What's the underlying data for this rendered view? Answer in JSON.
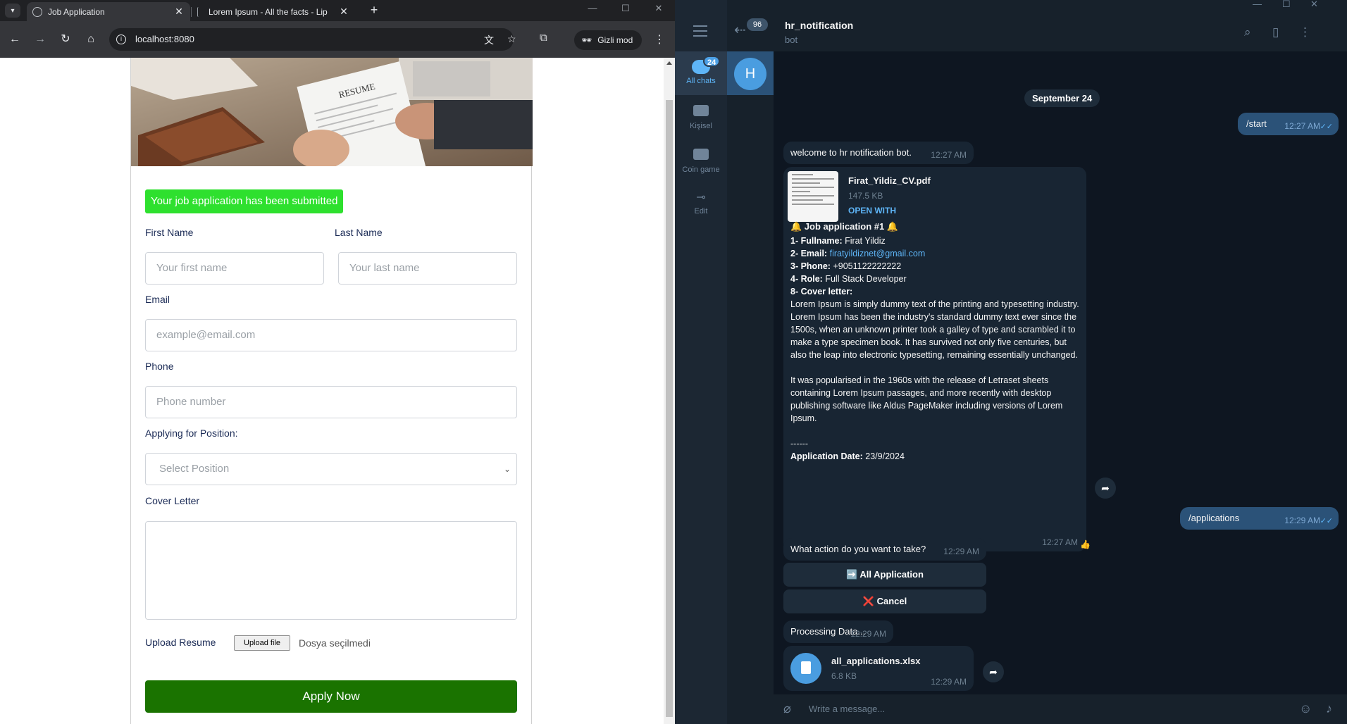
{
  "browser": {
    "tabs": [
      {
        "title": "Job Application"
      },
      {
        "title": "Lorem Ipsum - All the facts - Lip"
      }
    ],
    "url": "localhost:8080",
    "incognito_label": "Gizli mod"
  },
  "form": {
    "success_message": "Your job application has been submitted",
    "first_name": {
      "label": "First Name",
      "placeholder": "Your first name"
    },
    "last_name": {
      "label": "Last Name",
      "placeholder": "Your last name"
    },
    "email": {
      "label": "Email",
      "placeholder": "example@email.com"
    },
    "phone": {
      "label": "Phone",
      "placeholder": "Phone number"
    },
    "position": {
      "label": "Applying for Position:",
      "selected": "Select Position"
    },
    "cover_letter": {
      "label": "Cover Letter"
    },
    "resume": {
      "label": "Upload Resume",
      "button": "Upload file",
      "status": "Dosya seçilmedi"
    },
    "submit_label": "Apply Now",
    "hero_text": "RESUME"
  },
  "telegram": {
    "folders": [
      {
        "label": "All chats",
        "badge": "24",
        "icon": "chat-bubble-icon"
      },
      {
        "label": "Kişisel",
        "icon": "folder-icon"
      },
      {
        "label": "Coin game",
        "icon": "folder-icon"
      },
      {
        "label": "Edit",
        "icon": "sliders-icon"
      }
    ],
    "back_badge": "96",
    "chat_avatar_letter": "H",
    "chat": {
      "name": "hr_notification",
      "status": "bot"
    },
    "date_chip": "September 24",
    "messages": {
      "start": {
        "text": "/start",
        "time": "12:27 AM"
      },
      "welcome": {
        "text": "welcome to hr notification bot.",
        "time": "12:27 AM"
      },
      "cv": {
        "file_name": "Firat_Yildiz_CV.pdf",
        "file_size": "147.5 KB",
        "open_with": "OPEN WITH",
        "heading": "🔔 Job application #1 🔔",
        "fullname_label": "1- Fullname:",
        "fullname": "Firat Yildiz",
        "email_label": "2- Email:",
        "email": "firatyildiznet@gmail.com",
        "phone_label": "3- Phone:",
        "phone": "+9051122222222",
        "role_label": "4- Role:",
        "role": "Full Stack Developer",
        "cover_label": "8- Cover letter:",
        "cover_p1": "Lorem Ipsum is simply dummy text of the printing and typesetting industry. Lorem Ipsum has been the industry's standard dummy text ever since the 1500s, when an unknown printer took a galley of type and scrambled it to make a type specimen book. It has survived not only five centuries, but also the leap into electronic typesetting, remaining essentially unchanged.",
        "cover_p2": "It was popularised in the 1960s with the release of Letraset sheets containing Lorem Ipsum passages, and more recently with desktop publishing software like Aldus PageMaker including versions of Lorem Ipsum.",
        "divider": "------",
        "date_label": "Application Date:",
        "date": "23/9/2024",
        "time": "12:27 AM",
        "reaction": "👍"
      },
      "applications": {
        "text": "/applications",
        "time": "12:29 AM"
      },
      "action": {
        "text": "What action do you want to take?",
        "time": "12:29 AM"
      },
      "keyboard": [
        {
          "icon": "➡️",
          "label": "All Application"
        },
        {
          "icon": "❌",
          "label": "Cancel"
        }
      ],
      "processing": {
        "text": "Processing Data...",
        "time": "12:29 AM"
      },
      "xlsx": {
        "file_name": "all_applications.xlsx",
        "file_size": "6.8 KB",
        "time": "12:29 AM"
      }
    },
    "input_placeholder": "Write a message..."
  },
  "colors": {
    "success_bg": "#2ee02e",
    "apply_bg": "#1a7300",
    "tg_bg": "#0e1621",
    "tg_out_bubble": "#2b5278",
    "tg_in_bubble": "#182533",
    "tg_accent": "#5eb5f7"
  }
}
